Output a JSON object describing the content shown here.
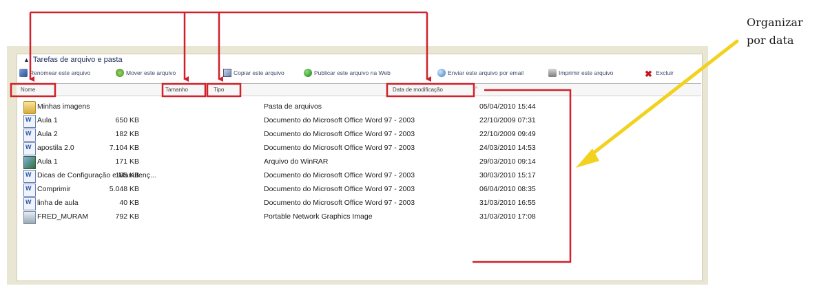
{
  "callout": {
    "line1": "Organizar",
    "line2": "por data"
  },
  "task_pane": {
    "title": "Tarefas de arquivo e pasta"
  },
  "toolbar": {
    "rename": "Renomear este arquivo",
    "move": "Mover este arquivo",
    "copy": "Copiar este arquivo",
    "publish": "Publicar este arquivo na Web",
    "email": "Enviar este arquivo por email",
    "print": "Imprimir este arquivo",
    "delete": "Excluir"
  },
  "columns": {
    "name": "Nome",
    "size": "Tamanho",
    "type": "Tipo",
    "modified": "Data de modificação"
  },
  "files": [
    {
      "name": "Minhas imagens",
      "size": "",
      "type": "Pasta de arquivos",
      "modified": "05/04/2010 15:44",
      "icon": "folder-icon"
    },
    {
      "name": "Aula 1",
      "size": "650 KB",
      "type": "Documento do Microsoft Office Word 97 - 2003",
      "modified": "22/10/2009 07:31",
      "icon": "word-document-icon"
    },
    {
      "name": "Aula 2",
      "size": "182 KB",
      "type": "Documento do Microsoft Office Word 97 - 2003",
      "modified": "22/10/2009 09:49",
      "icon": "word-document-icon"
    },
    {
      "name": "apostila 2.0",
      "size": "7.104 KB",
      "type": "Documento do Microsoft Office Word 97 - 2003",
      "modified": "24/03/2010 14:53",
      "icon": "word-document-icon"
    },
    {
      "name": "Aula 1",
      "size": "171 KB",
      "type": "Arquivo do WinRAR",
      "modified": "29/03/2010 09:14",
      "icon": "winrar-archive-icon"
    },
    {
      "name": "Dicas de Configuração e Manutenç...",
      "size": "185 KB",
      "type": "Documento do Microsoft Office Word 97 - 2003",
      "modified": "30/03/2010 15:17",
      "icon": "word-document-icon"
    },
    {
      "name": "Comprimir",
      "size": "5.048 KB",
      "type": "Documento do Microsoft Office Word 97 - 2003",
      "modified": "06/04/2010 08:35",
      "icon": "word-document-icon"
    },
    {
      "name": "linha de aula",
      "size": "40 KB",
      "type": "Documento do Microsoft Office Word 97 - 2003",
      "modified": "31/03/2010 16:55",
      "icon": "word-document-icon"
    },
    {
      "name": "FRED_MURAM",
      "size": "792 KB",
      "type": "Portable Network Graphics Image",
      "modified": "31/03/2010 17:08",
      "icon": "png-image-icon"
    }
  ],
  "colors": {
    "annotation_red": "#d0202a",
    "arrow_yellow": "#f2d21e"
  }
}
